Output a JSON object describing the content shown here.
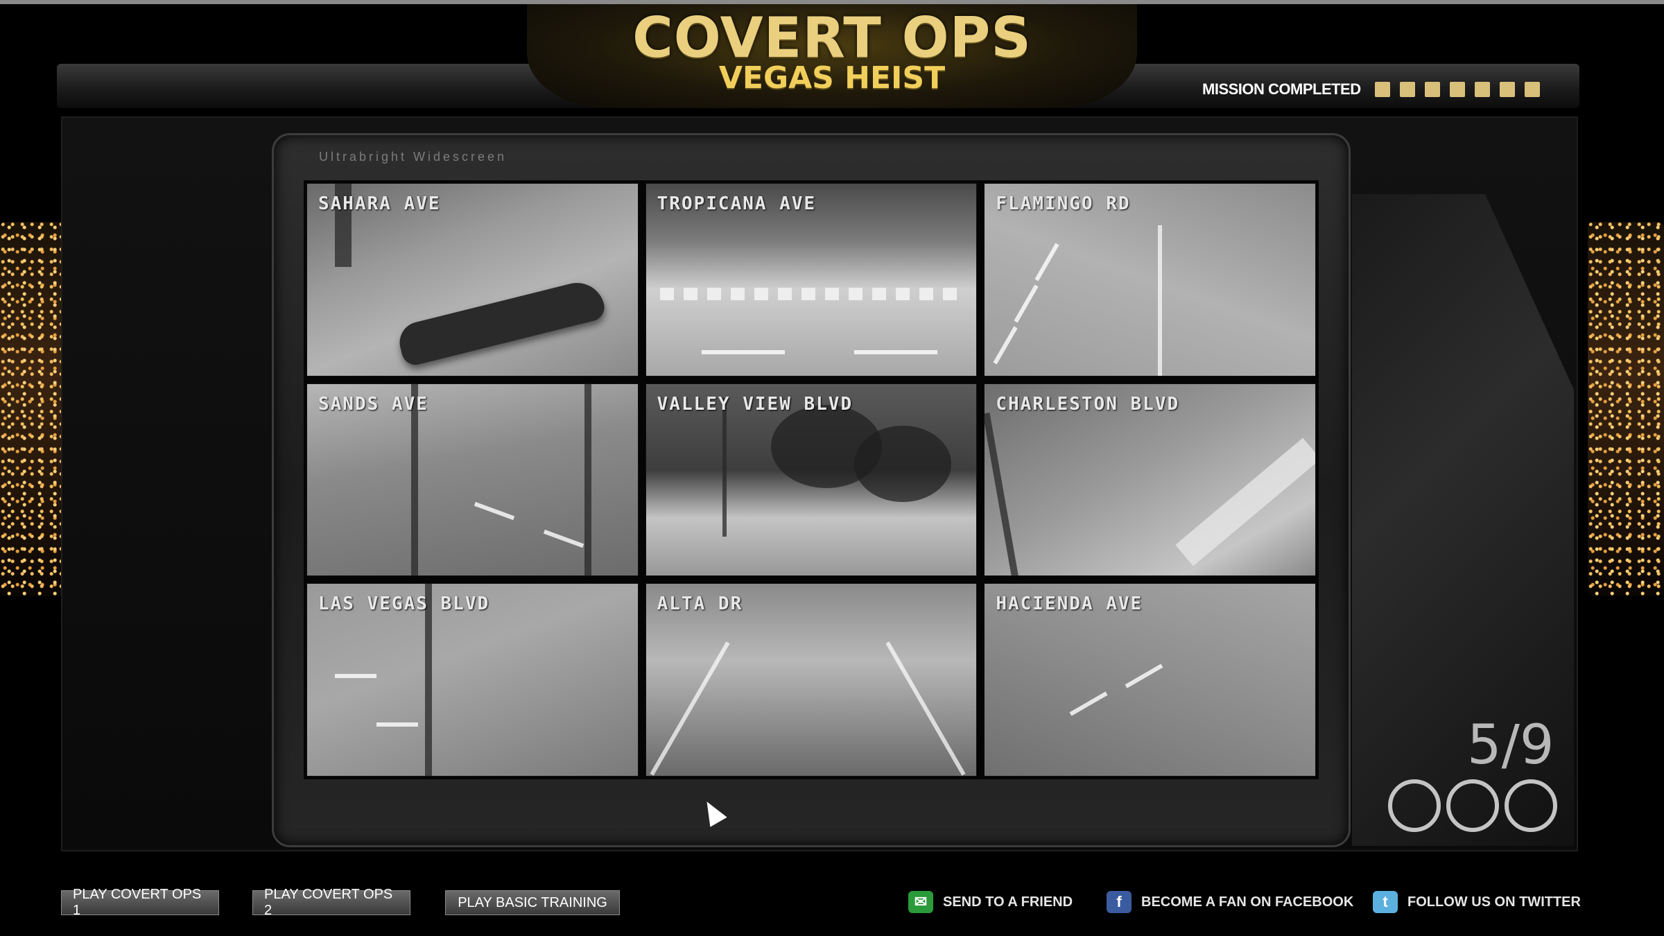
{
  "header": {
    "title": "COVERT OPS",
    "subtitle": "VEGAS HEIST",
    "mission_label": "MISSION COMPLETED",
    "mission_total": 7,
    "mission_color": "#d9c07a"
  },
  "monitor": {
    "brand": "Ultrabright Widescreen",
    "cameras": [
      {
        "label": "SAHARA AVE"
      },
      {
        "label": "TROPICANA AVE"
      },
      {
        "label": "FLAMINGO RD"
      },
      {
        "label": "SANDS AVE"
      },
      {
        "label": "VALLEY VIEW BLVD"
      },
      {
        "label": "CHARLESTON BLVD"
      },
      {
        "label": "LAS VEGAS BLVD"
      },
      {
        "label": "ALTA DR"
      },
      {
        "label": "HACIENDA AVE"
      }
    ]
  },
  "progress": {
    "counter": "5/9",
    "current": 5,
    "total": 9
  },
  "footer": {
    "play_covert_ops_1": "PLAY COVERT OPS 1",
    "play_covert_ops_2": "PLAY COVERT OPS 2",
    "play_basic_training": "PLAY BASIC TRAINING",
    "send_to_friend": "SEND TO A FRIEND",
    "facebook": "BECOME A FAN ON FACEBOOK",
    "twitter": "FOLLOW US ON TWITTER"
  },
  "icons": {
    "send": "share-icon",
    "facebook": "facebook-icon",
    "twitter": "twitter-icon"
  }
}
